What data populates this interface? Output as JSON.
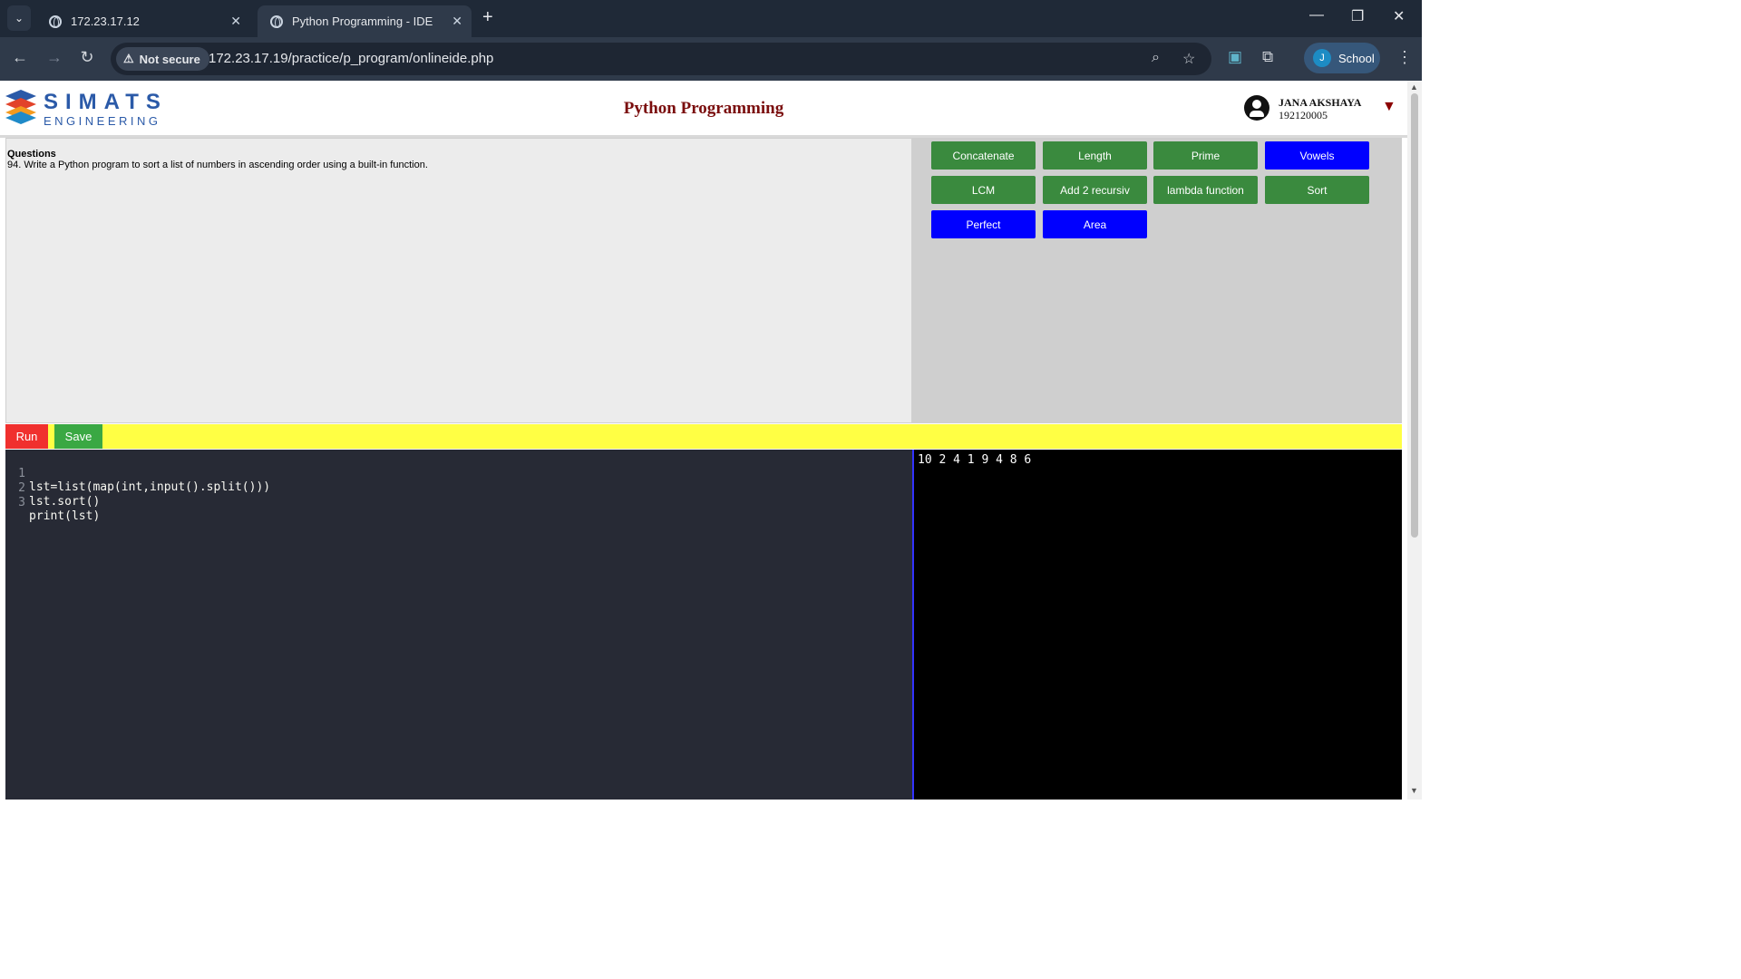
{
  "browser": {
    "tabs": [
      {
        "title": "172.23.17.12",
        "active": false
      },
      {
        "title": "Python Programming - IDE",
        "active": true
      }
    ],
    "security_label": "Not secure",
    "url": "172.23.17.19/practice/p_program/onlineide.php",
    "profile_initial": "J",
    "profile_name": "School"
  },
  "header": {
    "logo_line1": "SIMATS",
    "logo_line2": "ENGINEERING",
    "title": "Python Programming",
    "user_name": "JANA AKSHAYA",
    "user_id": "192120005"
  },
  "question": {
    "label": "Questions",
    "text": "94. Write a Python program to sort a list of numbers in ascending order using a built-in function."
  },
  "question_buttons": [
    {
      "label": "Concatenate",
      "color": "#3a8a3e"
    },
    {
      "label": "Length",
      "color": "#3a8a3e"
    },
    {
      "label": "Prime",
      "color": "#3a8a3e"
    },
    {
      "label": "Vowels",
      "color": "#0000ff"
    },
    {
      "label": "LCM",
      "color": "#3a8a3e"
    },
    {
      "label": "Add 2 recursiv",
      "color": "#3a8a3e"
    },
    {
      "label": "lambda function",
      "color": "#3a8a3e"
    },
    {
      "label": "Sort",
      "color": "#3a8a3e"
    },
    {
      "label": "Perfect",
      "color": "#0000ff"
    },
    {
      "label": "Area",
      "color": "#0000ff"
    }
  ],
  "actions": {
    "run_label": "Run",
    "save_label": "Save"
  },
  "editor": {
    "lines": [
      {
        "no": "1",
        "code": "lst=list(map(int,input().split()))"
      },
      {
        "no": "2",
        "code": "lst.sort()"
      },
      {
        "no": "3",
        "code": "print(lst)"
      }
    ]
  },
  "output": {
    "text": "10 2 4 1 9 4 8 6"
  }
}
